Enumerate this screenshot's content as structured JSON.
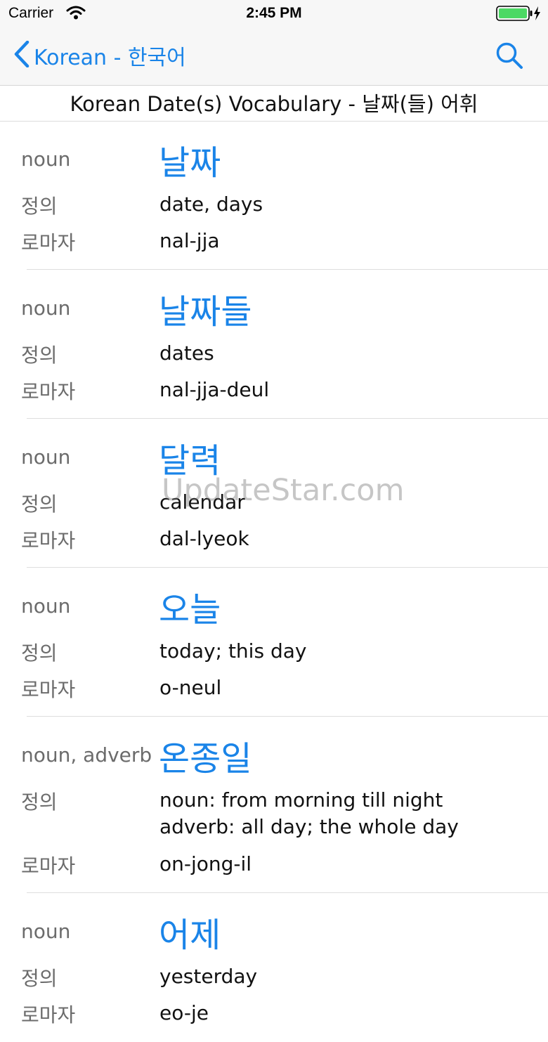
{
  "status_bar": {
    "carrier": "Carrier",
    "time": "2:45 PM"
  },
  "nav": {
    "back_label": "Korean - 한국어"
  },
  "subtitle": "Korean Date(s) Vocabulary - 날짜(들) 어휘",
  "labels": {
    "definition": "정의",
    "romanization": "로마자"
  },
  "entries": [
    {
      "pos": "noun",
      "word": "날짜",
      "definition": "date, days",
      "romanization": "nal-jja"
    },
    {
      "pos": "noun",
      "word": "날짜들",
      "definition": "dates",
      "romanization": "nal-jja-deul"
    },
    {
      "pos": "noun",
      "word": "달력",
      "definition": "calendar",
      "romanization": "dal-lyeok"
    },
    {
      "pos": "noun",
      "word": "오늘",
      "definition": "today; this day",
      "romanization": "o-neul"
    },
    {
      "pos": "noun, adverb",
      "word": "온종일",
      "definition_line1": "noun: from morning till night",
      "definition_line2": "adverb: all day; the whole day",
      "romanization": "on-jong-il"
    },
    {
      "pos": "noun",
      "word": "어제",
      "definition": "yesterday",
      "romanization": "eo-je"
    }
  ],
  "watermark": "UpdateStar.com",
  "colors": {
    "accent": "#1a84e8",
    "battery": "#4cd964"
  },
  "icons": [
    "wifi-icon",
    "battery-icon",
    "charging-bolt-icon",
    "chevron-left-icon",
    "search-icon"
  ]
}
